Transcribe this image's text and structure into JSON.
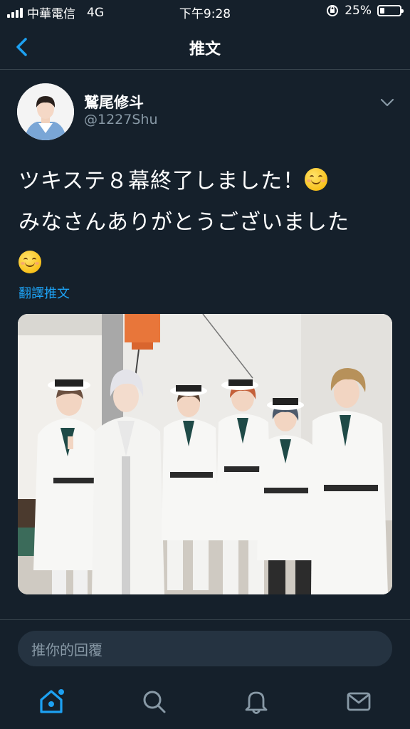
{
  "status_bar": {
    "carrier": "中華電信",
    "network": "4G",
    "time": "下午9:28",
    "battery_percent": "25%",
    "battery_level": 0.25
  },
  "nav": {
    "title": "推文",
    "back_icon": "chevron-left-icon"
  },
  "tweet": {
    "author": {
      "display_name": "鷲尾修斗",
      "handle": "@1227Shu"
    },
    "lines": [
      "ツキステ８幕終了しました！",
      "みなさんありがとうございました"
    ],
    "emoji": "smiling-face-emoji",
    "translate_label": "翻譯推文"
  },
  "reply": {
    "placeholder": "推你的回覆"
  },
  "tabbar": {
    "items": [
      "home-icon",
      "search-icon",
      "bell-icon",
      "mail-icon"
    ]
  },
  "colors": {
    "background": "#15202b",
    "accent": "#1da1f2",
    "muted": "#8899a6",
    "input_bg": "#253341",
    "divider": "#38444d"
  }
}
